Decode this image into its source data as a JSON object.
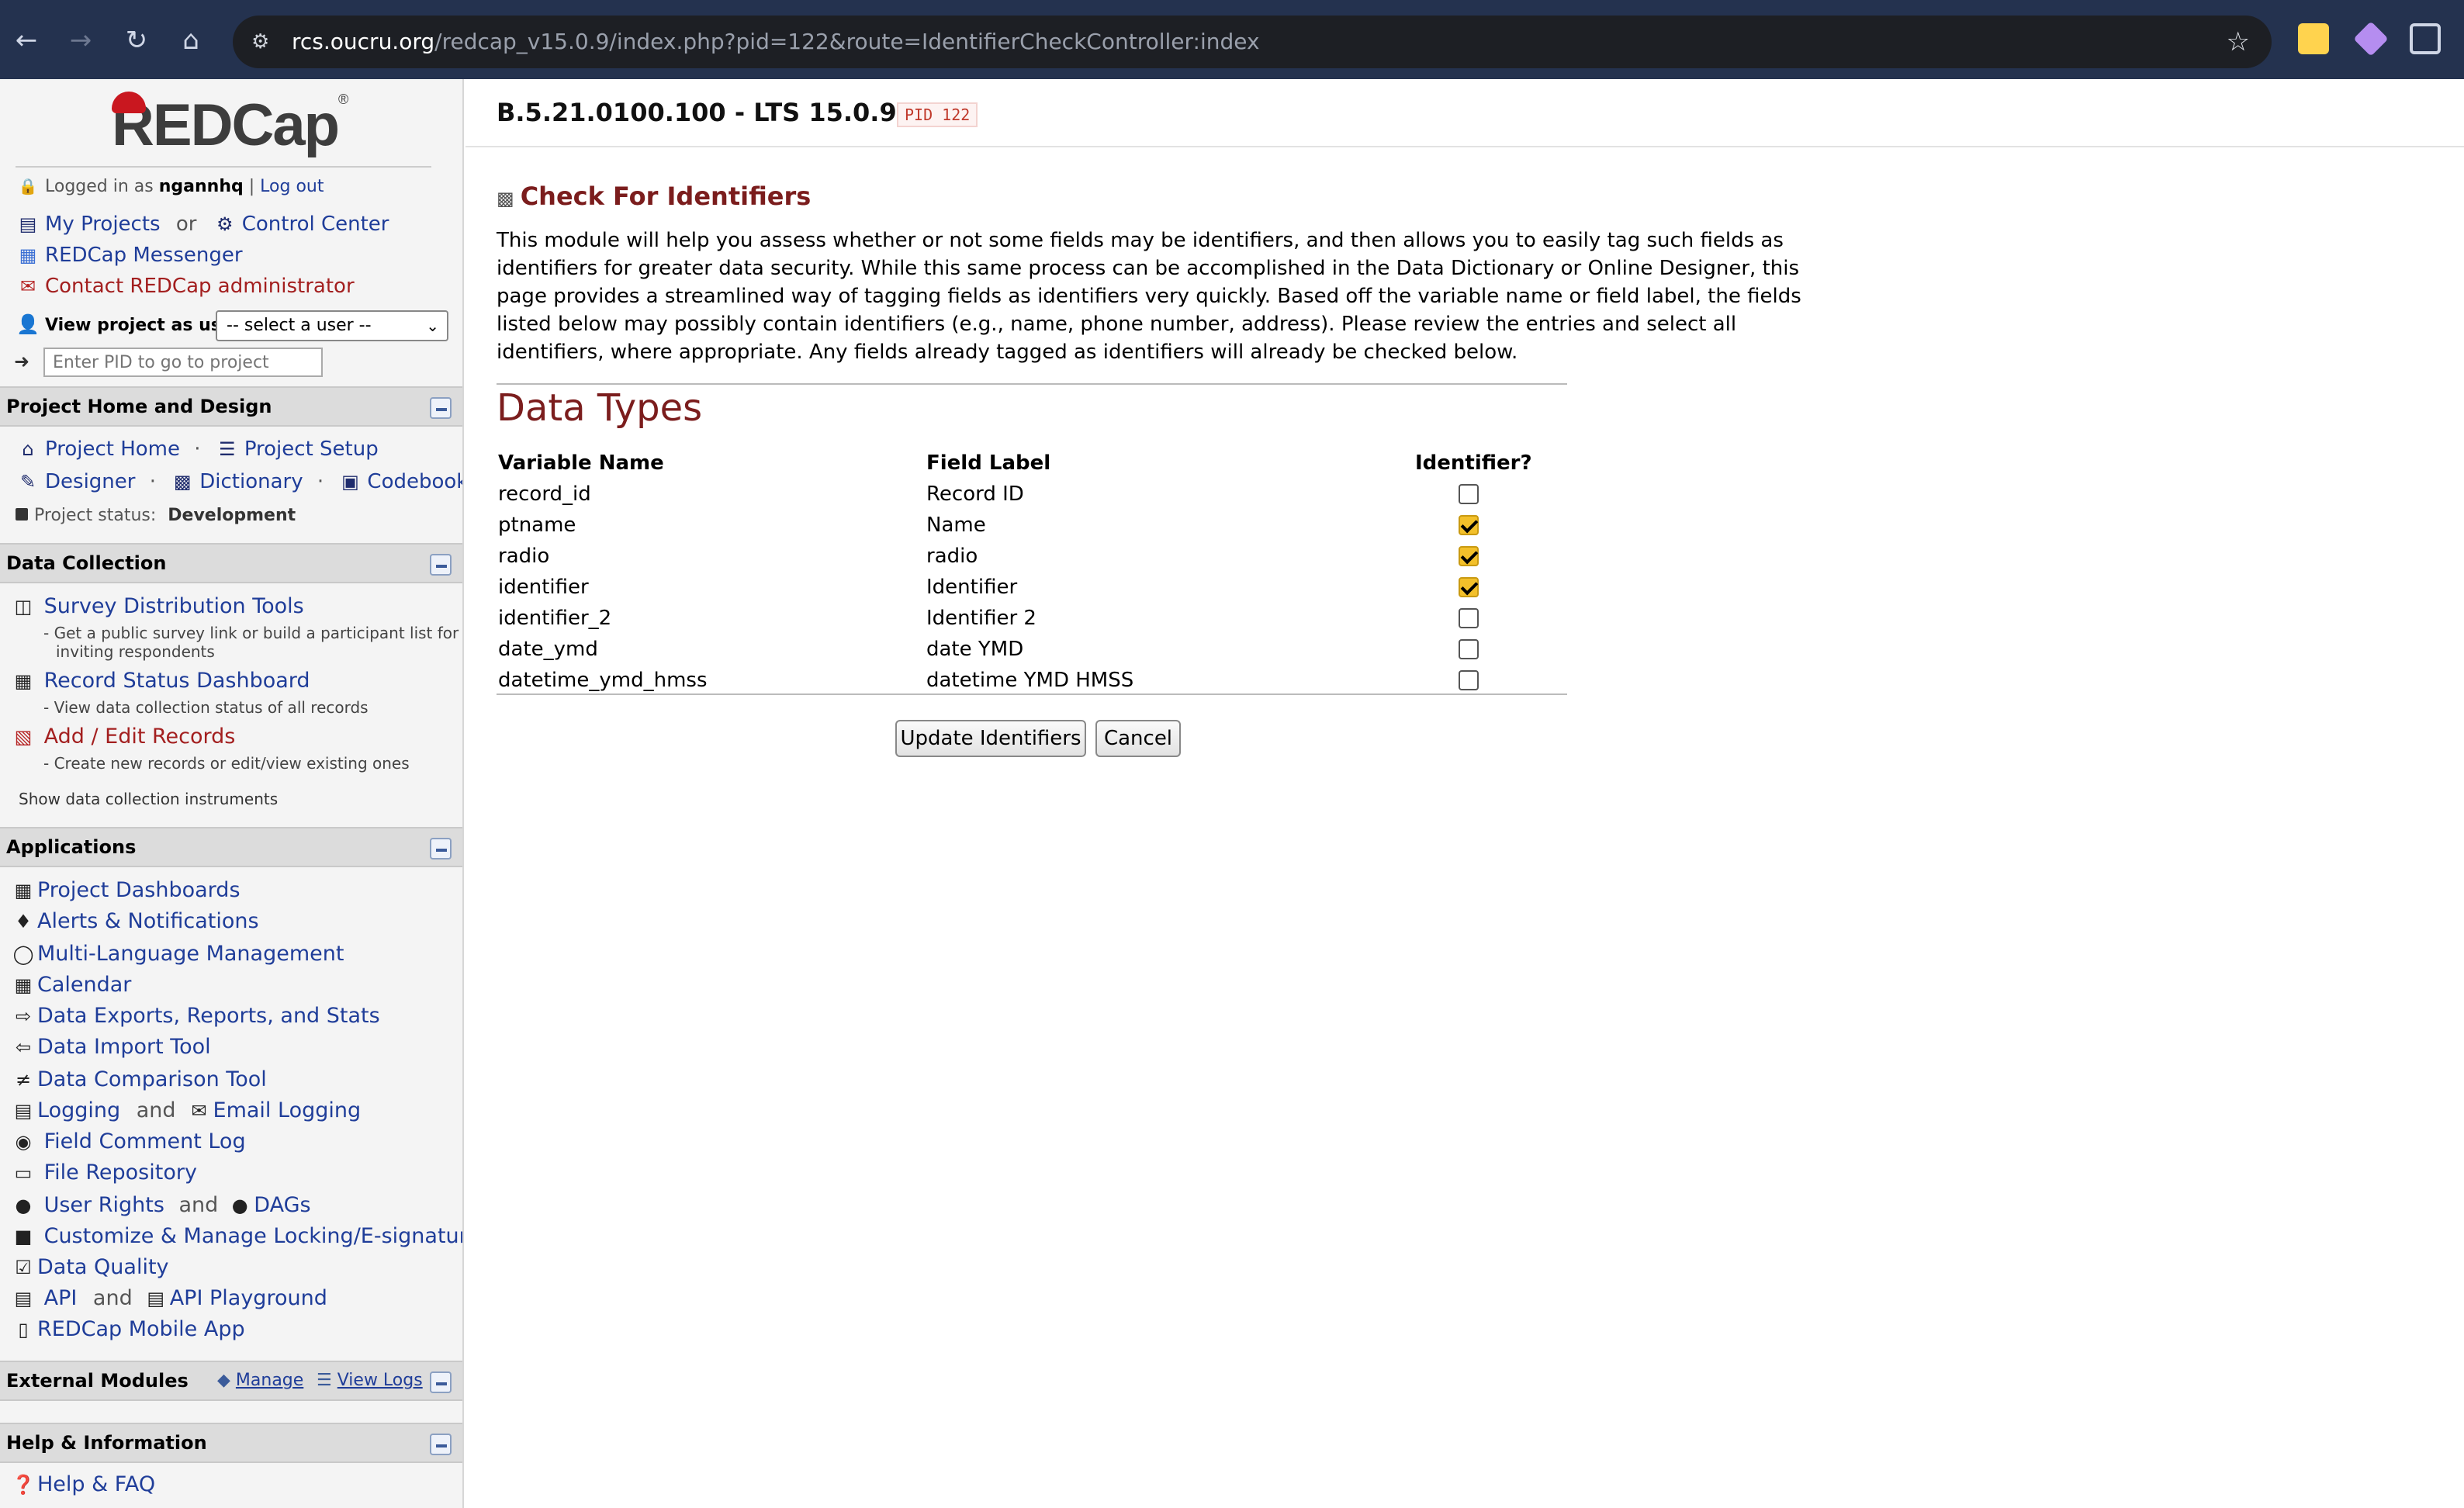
{
  "browser": {
    "url_host": "rcs.oucru.org",
    "url_path": "/redcap_v15.0.9/index.php?pid=122&route=IdentifierCheckController:index"
  },
  "sidebar": {
    "logo": "REDCap",
    "logged_in_prefix": "Logged in as",
    "username": "ngannhq",
    "logout": "Log out",
    "my_projects": "My Projects",
    "or": "or",
    "control_center": "Control Center",
    "messenger": "REDCap Messenger",
    "contact_admin": "Contact REDCap administrator",
    "view_as_label": "View project as user:",
    "view_as_value": "-- select a user --",
    "pid_placeholder": "Enter PID to go to project",
    "sections": {
      "home_design": "Project Home and Design",
      "data_collection": "Data Collection",
      "applications": "Applications",
      "external_modules": "External Modules",
      "help": "Help & Information"
    },
    "home_design": {
      "project_home": "Project Home",
      "project_setup": "Project Setup",
      "designer": "Designer",
      "dictionary": "Dictionary",
      "codebook": "Codebook",
      "status_label": "Project status:",
      "status_value": "Development"
    },
    "data_collection": {
      "survey_tools": "Survey Distribution Tools",
      "survey_desc_1": "- Get a public survey link or build a participant list for",
      "survey_desc_2": "inviting respondents",
      "record_dashboard": "Record Status Dashboard",
      "record_desc": "- View data collection status of all records",
      "add_edit": "Add / Edit Records",
      "add_edit_desc": "- Create new records or edit/view existing ones",
      "show_instruments": "Show data collection instruments"
    },
    "applications": {
      "items": [
        "Project Dashboards",
        "Alerts & Notifications",
        "Multi-Language Management",
        "Calendar",
        "Data Exports, Reports, and Stats",
        "Data Import Tool",
        "Data Comparison Tool",
        "Logging",
        "Field Comment Log",
        "File Repository",
        "User Rights",
        "Customize & Manage Locking/E-signatures",
        "Data Quality",
        "API",
        "REDCap Mobile App"
      ],
      "and": "and",
      "email_logging": "Email Logging",
      "dags": "DAGs",
      "api_playground": "API Playground"
    },
    "external_modules": {
      "manage": "Manage",
      "view_logs": "View Logs"
    },
    "help": {
      "faq": "Help & FAQ"
    }
  },
  "main": {
    "project_title": "B.5.21.0100.100 - LTS 15.0.9",
    "pid_badge": "PID 122",
    "page_heading": "Check For Identifiers",
    "intro": "This module will help you assess whether or not some fields may be identifiers, and then allows you to easily tag such fields as identifiers for greater data security. While this same process can be accomplished in the Data Dictionary or Online Designer, this page provides a streamlined way of tagging fields as identifiers very quickly. Based off the variable name or field label, the fields listed below may possibly contain identifiers (e.g., name, phone number, address). Please review the entries and select all identifiers, where appropriate. Any fields already tagged as identifiers will already be checked below.",
    "data_types_title": "Data Types",
    "columns": {
      "variable": "Variable Name",
      "label": "Field Label",
      "identifier": "Identifier?"
    },
    "rows": [
      {
        "variable": "record_id",
        "label": "Record ID",
        "identifier": false
      },
      {
        "variable": "ptname",
        "label": "Name",
        "identifier": true
      },
      {
        "variable": "radio",
        "label": "radio",
        "identifier": true
      },
      {
        "variable": "identifier",
        "label": "Identifier",
        "identifier": true
      },
      {
        "variable": "identifier_2",
        "label": "Identifier 2",
        "identifier": false
      },
      {
        "variable": "date_ymd",
        "label": "date YMD",
        "identifier": false
      },
      {
        "variable": "datetime_ymd_hmss",
        "label": "datetime YMD HMSS",
        "identifier": false
      }
    ],
    "update_button": "Update Identifiers",
    "cancel_button": "Cancel"
  },
  "colors": {
    "heading": "#7b1d1d",
    "link": "#1f3d99",
    "checkbox_checked": "#f3c02a",
    "browser_bar": "#24324f"
  }
}
